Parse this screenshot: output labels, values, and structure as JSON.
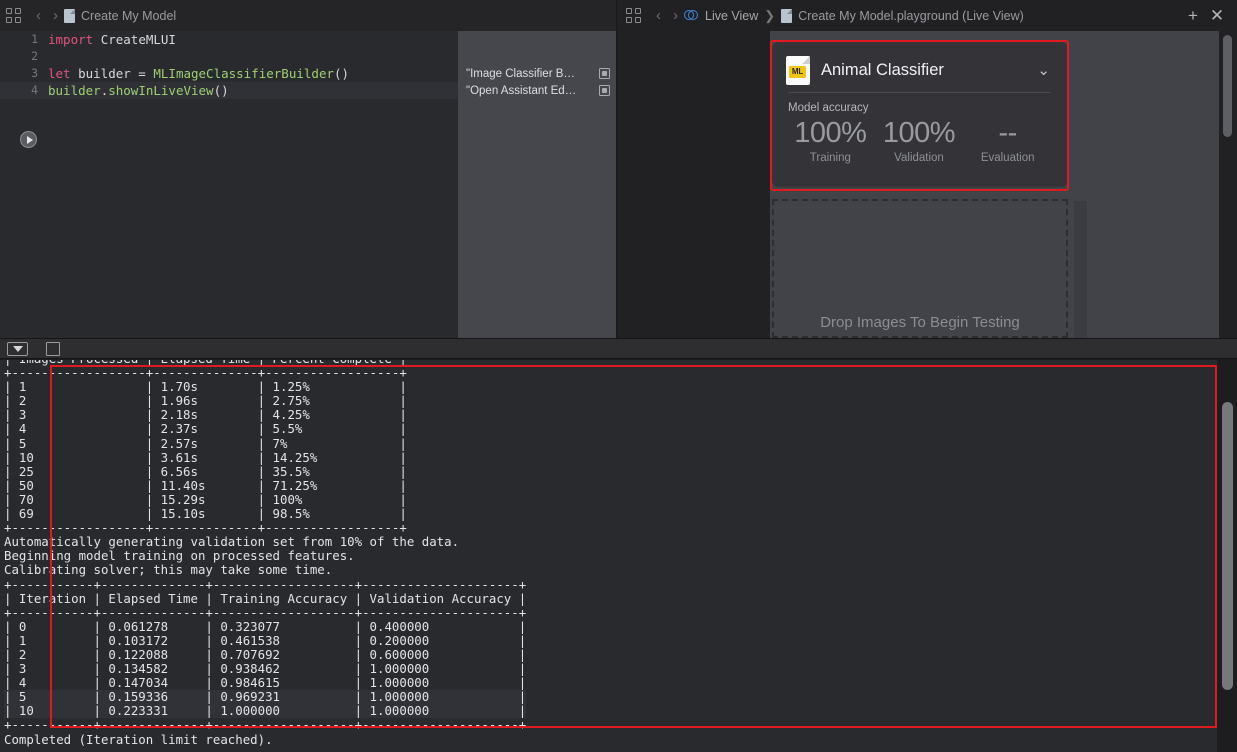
{
  "window": {
    "left_pane": {
      "grid_icon": "grid-icon",
      "back_icon": "‹",
      "forward_icon": "›",
      "breadcrumb_document": "Create My Model"
    },
    "right_pane": {
      "grid_icon": "grid-icon",
      "back_icon": "‹",
      "forward_icon": "›",
      "breadcrumb_live_view": "Live View",
      "breadcrumb_separator": "❯",
      "breadcrumb_document": "Create My Model.playground (Live View)",
      "add_icon": "+",
      "close_icon": "✕"
    }
  },
  "editor": {
    "lines": [
      {
        "number": "1",
        "tokens": [
          {
            "t": "import",
            "c": "kw"
          },
          {
            "t": " ",
            "c": "pl"
          },
          {
            "t": "CreateMLUI",
            "c": "pl"
          }
        ]
      },
      {
        "number": "2",
        "tokens": []
      },
      {
        "number": "3",
        "tokens": [
          {
            "t": "let",
            "c": "kw"
          },
          {
            "t": " builder = ",
            "c": "pl"
          },
          {
            "t": "MLImageClassifierBuilder",
            "c": "type"
          },
          {
            "t": "()",
            "c": "pl"
          }
        ]
      },
      {
        "number": "4",
        "tokens": [
          {
            "t": "builder",
            "c": "fn"
          },
          {
            "t": ".",
            "c": "pl"
          },
          {
            "t": "showInLiveView",
            "c": "fn"
          },
          {
            "t": "()",
            "c": "pl"
          }
        ],
        "highlighted": true
      }
    ],
    "run_button": "run-playground-button",
    "results_sidebar": [
      {
        "text": "\"Image Classifier B…",
        "chip": "show-result-icon"
      },
      {
        "text": "\"Open Assistant Ed…",
        "chip": "show-result-icon"
      }
    ]
  },
  "live_view": {
    "classifier_card": {
      "icon": "ml-model-document-icon",
      "icon_badge": "ML",
      "title": "Animal Classifier",
      "disclosure_icon": "⌄",
      "section_label": "Model accuracy",
      "metrics": [
        {
          "value": "100%",
          "label": "Training"
        },
        {
          "value": "100%",
          "label": "Validation"
        },
        {
          "value": "--",
          "label": "Evaluation"
        }
      ]
    },
    "drop_zone": {
      "text": "Drop Images To Begin Testing"
    }
  },
  "debug_bar": {
    "filter_button": "show-hide-console-button",
    "panel_button": "show-hide-variables-button"
  },
  "console": {
    "text": "| Images Processed | Elapsed Time | Percent Complete |\n+------------------+--------------+------------------+\n| 1                | 1.70s        | 1.25%            |\n| 2                | 1.96s        | 2.75%            |\n| 3                | 2.18s        | 4.25%            |\n| 4                | 2.37s        | 5.5%             |\n| 5                | 2.57s        | 7%               |\n| 10               | 3.61s        | 14.25%           |\n| 25               | 6.56s        | 35.5%            |\n| 50               | 11.40s       | 71.25%           |\n| 70               | 15.29s       | 100%             |\n| 69               | 15.10s       | 98.5%            |\n+------------------+--------------+------------------+\nAutomatically generating validation set from 10% of the data.\nBeginning model training on processed features.\nCalibrating solver; this may take some time.\n+-----------+--------------+-------------------+---------------------+\n| Iteration | Elapsed Time | Training Accuracy | Validation Accuracy |\n+-----------+--------------+-------------------+---------------------+\n| 0         | 0.061278     | 0.323077          | 0.400000            |\n| 1         | 0.103172     | 0.461538          | 0.200000            |\n| 2         | 0.122088     | 0.707692          | 0.600000            |\n| 3         | 0.134582     | 0.938462          | 1.000000            |\n| 4         | 0.147034     | 0.984615          | 1.000000            |\n| 5         | 0.159336     | 0.969231          | 1.000000            |\n| 10        | 0.223331     | 1.000000          | 1.000000            |\n+-----------+--------------+-------------------+---------------------+\nCompleted (Iteration limit reached).",
    "tables": [
      {
        "columns": [
          "Images Processed",
          "Elapsed Time",
          "Percent Complete"
        ],
        "rows": [
          [
            "1",
            "1.70s",
            "1.25%"
          ],
          [
            "2",
            "1.96s",
            "2.75%"
          ],
          [
            "3",
            "2.18s",
            "4.25%"
          ],
          [
            "4",
            "2.37s",
            "5.5%"
          ],
          [
            "5",
            "2.57s",
            "7%"
          ],
          [
            "10",
            "3.61s",
            "14.25%"
          ],
          [
            "25",
            "6.56s",
            "35.5%"
          ],
          [
            "50",
            "11.40s",
            "71.25%"
          ],
          [
            "70",
            "15.29s",
            "100%"
          ],
          [
            "69",
            "15.10s",
            "98.5%"
          ]
        ]
      },
      {
        "columns": [
          "Iteration",
          "Elapsed Time",
          "Training Accuracy",
          "Validation Accuracy"
        ],
        "rows": [
          [
            "0",
            "0.061278",
            "0.323077",
            "0.400000"
          ],
          [
            "1",
            "0.103172",
            "0.461538",
            "0.200000"
          ],
          [
            "2",
            "0.122088",
            "0.707692",
            "0.600000"
          ],
          [
            "3",
            "0.134582",
            "0.938462",
            "1.000000"
          ],
          [
            "4",
            "0.147034",
            "0.984615",
            "1.000000"
          ],
          [
            "5",
            "0.159336",
            "0.969231",
            "1.000000"
          ],
          [
            "10",
            "0.223331",
            "1.000000",
            "1.000000"
          ]
        ]
      }
    ],
    "messages": [
      "Automatically generating validation set from 10% of the data.",
      "Beginning model training on processed features.",
      "Calibrating solver; this may take some time.",
      "Completed (Iteration limit reached)."
    ]
  },
  "annotations": {
    "color": "#e01b20",
    "boxes": [
      "classifier-card-highlight",
      "console-output-highlight"
    ]
  }
}
